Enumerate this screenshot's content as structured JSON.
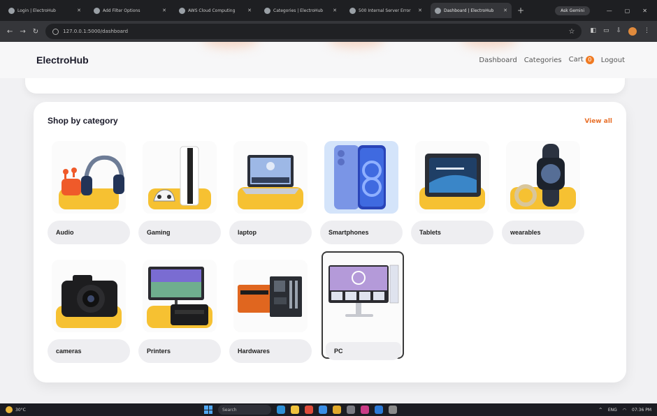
{
  "browser": {
    "tabs": [
      {
        "title": "Login | ElectroHub",
        "active": false
      },
      {
        "title": "Add Filter Options",
        "active": false
      },
      {
        "title": "AWS Cloud Computing",
        "active": false
      },
      {
        "title": "Categories | ElectroHub",
        "active": false
      },
      {
        "title": "500 Internal Server Error",
        "active": false
      },
      {
        "title": "Dashboard | ElectroHub",
        "active": true
      }
    ],
    "new_tab": "+",
    "gemini_label": "Ask Gemini",
    "url": "127.0.0.1:5000/dashboard"
  },
  "navbar": {
    "brand": "ElectroHub",
    "links": {
      "dashboard": "Dashboard",
      "categories": "Categories",
      "cart": "Cart",
      "logout": "Logout"
    },
    "cart_count": "0"
  },
  "section": {
    "title": "Shop by category",
    "view_all": "View all"
  },
  "categories": [
    {
      "label": "Audio",
      "icon": "headphones-earbuds-image",
      "selected": false
    },
    {
      "label": "Gaming",
      "icon": "console-image",
      "selected": false
    },
    {
      "label": "laptop",
      "icon": "laptop-image",
      "selected": false
    },
    {
      "label": "Smartphones",
      "icon": "smartphone-image",
      "selected": false
    },
    {
      "label": "Tablets",
      "icon": "tablet-image",
      "selected": false
    },
    {
      "label": "wearables",
      "icon": "smartwatch-image",
      "selected": false
    },
    {
      "label": "cameras",
      "icon": "camera-image",
      "selected": false
    },
    {
      "label": "Printers",
      "icon": "printer-image",
      "selected": false
    },
    {
      "label": "Hardwares",
      "icon": "motherboard-image",
      "selected": false
    },
    {
      "label": "PC",
      "icon": "monitor-image",
      "selected": true
    }
  ],
  "taskbar": {
    "weather": "30°C",
    "search_placeholder": "Search",
    "lang": "ENG",
    "time": "07:36 PM"
  },
  "colors": {
    "accent": "#e8702a",
    "badge": "#f07a22",
    "tile_yellow": "#f6c132",
    "page_bg": "#f1f1f3"
  }
}
